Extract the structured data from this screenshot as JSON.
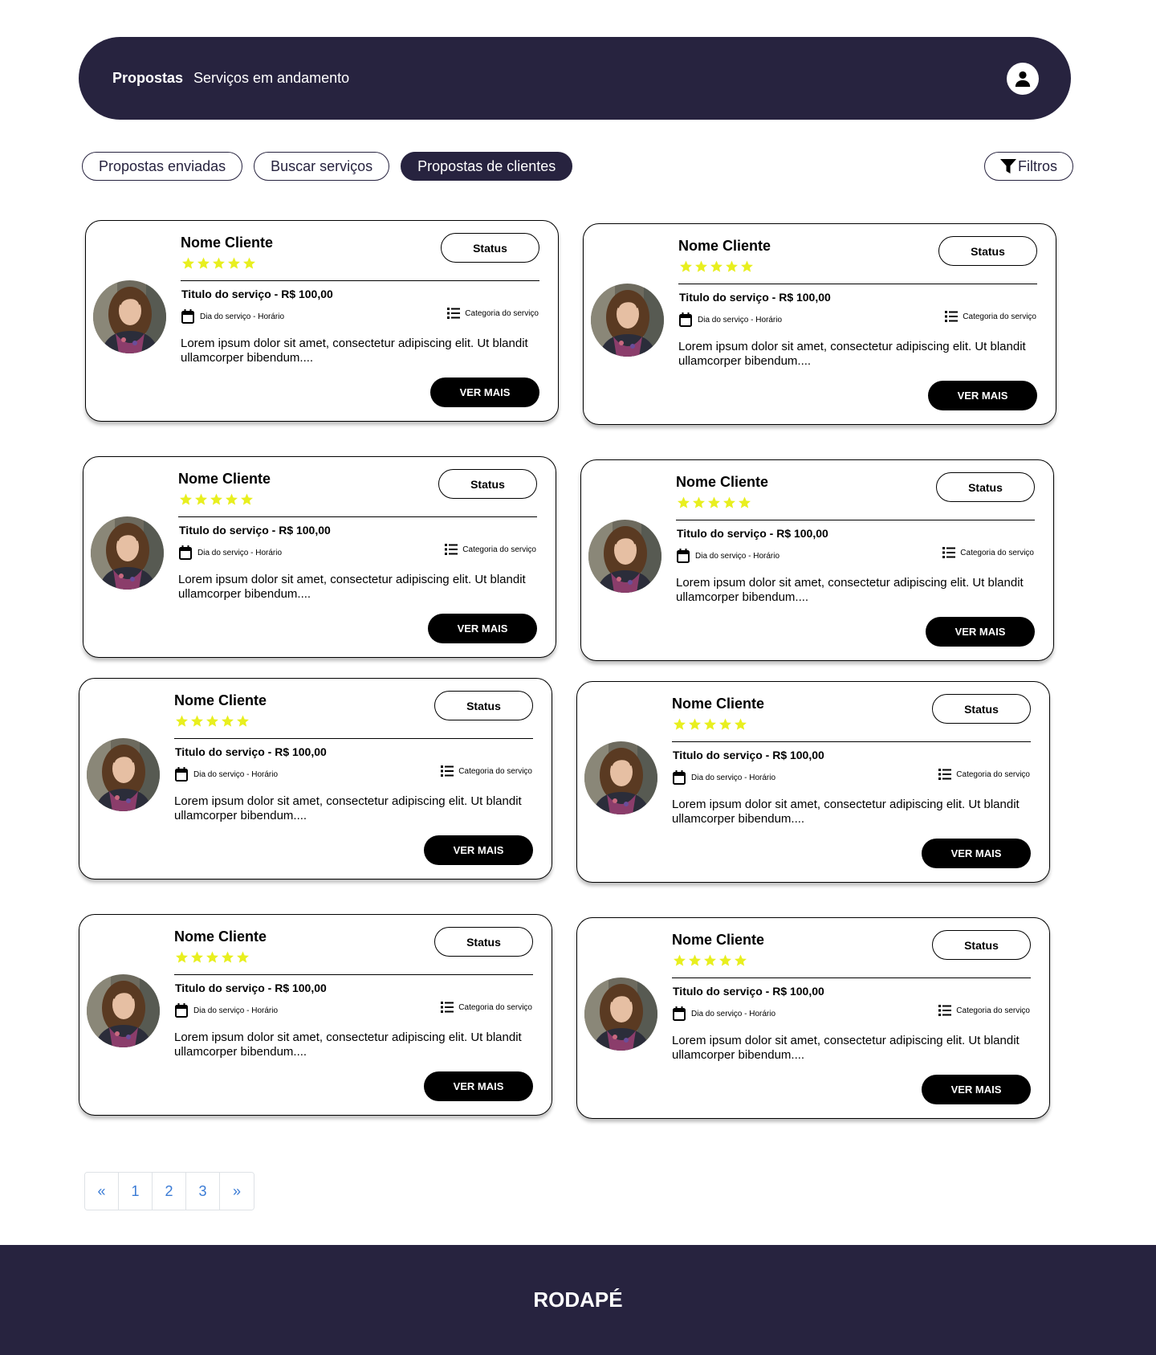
{
  "header": {
    "title": "Propostas",
    "subtitle": "Serviços em andamento",
    "user_icon": "user-icon",
    "background": "#27233f"
  },
  "tabs": [
    {
      "label": "Propostas enviadas",
      "active": false
    },
    {
      "label": "Buscar serviços",
      "active": false
    },
    {
      "label": "Propostas de clientes",
      "active": true
    }
  ],
  "filter": {
    "label": "Filtros",
    "icon": "filter-icon"
  },
  "card_template": {
    "client_name": "Nome Cliente",
    "rating": 5,
    "status_label": "Status",
    "service_title": "Titulo do serviço - R$ 100,00",
    "date_text": "Dia do serviço - Horário",
    "category_text": "Categoria do serviço",
    "description": "Lorem ipsum dolor sit amet, consectetur adipiscing elit. Ut blandit ullamcorper bibendum....",
    "more_label": "VER MAIS",
    "star_color": "#e8ef1f"
  },
  "cards": [
    {
      "client_name": "Nome Cliente",
      "status_label": "Status",
      "service_title": "Titulo do serviço - R$ 100,00",
      "date_text": "Dia do serviço - Horário",
      "category_text": "Categoria do serviço",
      "description": "Lorem ipsum dolor sit amet, consectetur adipiscing elit. Ut blandit ullamcorper bibendum....",
      "more_label": "VER MAIS"
    },
    {
      "client_name": "Nome Cliente",
      "status_label": "Status",
      "service_title": "Titulo do serviço - R$ 100,00",
      "date_text": "Dia do serviço - Horário",
      "category_text": "Categoria do serviço",
      "description": "Lorem ipsum dolor sit amet, consectetur adipiscing elit. Ut blandit ullamcorper bibendum....",
      "more_label": "VER MAIS"
    },
    {
      "client_name": "Nome Cliente",
      "status_label": "Status",
      "service_title": "Titulo do serviço - R$ 100,00",
      "date_text": "Dia do serviço - Horário",
      "category_text": "Categoria do serviço",
      "description": "Lorem ipsum dolor sit amet, consectetur adipiscing elit. Ut blandit ullamcorper bibendum....",
      "more_label": "VER MAIS"
    },
    {
      "client_name": "Nome Cliente",
      "status_label": "Status",
      "service_title": "Titulo do serviço - R$ 100,00",
      "date_text": "Dia do serviço - Horário",
      "category_text": "Categoria do serviço",
      "description": "Lorem ipsum dolor sit amet, consectetur adipiscing elit. Ut blandit ullamcorper bibendum....",
      "more_label": "VER MAIS"
    },
    {
      "client_name": "Nome Cliente",
      "status_label": "Status",
      "service_title": "Titulo do serviço - R$ 100,00",
      "date_text": "Dia do serviço - Horário",
      "category_text": "Categoria do serviço",
      "description": "Lorem ipsum dolor sit amet, consectetur adipiscing elit. Ut blandit ullamcorper bibendum....",
      "more_label": "VER MAIS"
    },
    {
      "client_name": "Nome Cliente",
      "status_label": "Status",
      "service_title": "Titulo do serviço - R$ 100,00",
      "date_text": "Dia do serviço - Horário",
      "category_text": "Categoria do serviço",
      "description": "Lorem ipsum dolor sit amet, consectetur adipiscing elit. Ut blandit ullamcorper bibendum....",
      "more_label": "VER MAIS"
    },
    {
      "client_name": "Nome Cliente",
      "status_label": "Status",
      "service_title": "Titulo do serviço - R$ 100,00",
      "date_text": "Dia do serviço - Horário",
      "category_text": "Categoria do serviço",
      "description": "Lorem ipsum dolor sit amet, consectetur adipiscing elit. Ut blandit ullamcorper bibendum....",
      "more_label": "VER MAIS"
    },
    {
      "client_name": "Nome Cliente",
      "status_label": "Status",
      "service_title": "Titulo do serviço - R$ 100,00",
      "date_text": "Dia do serviço - Horário",
      "category_text": "Categoria do serviço",
      "description": "Lorem ipsum dolor sit amet, consectetur adipiscing elit. Ut blandit ullamcorper bibendum....",
      "more_label": "VER MAIS"
    }
  ],
  "pagination": {
    "prev": "«",
    "pages": [
      "1",
      "2",
      "3"
    ],
    "next": "»"
  },
  "footer": {
    "label": "RODAPÉ"
  }
}
